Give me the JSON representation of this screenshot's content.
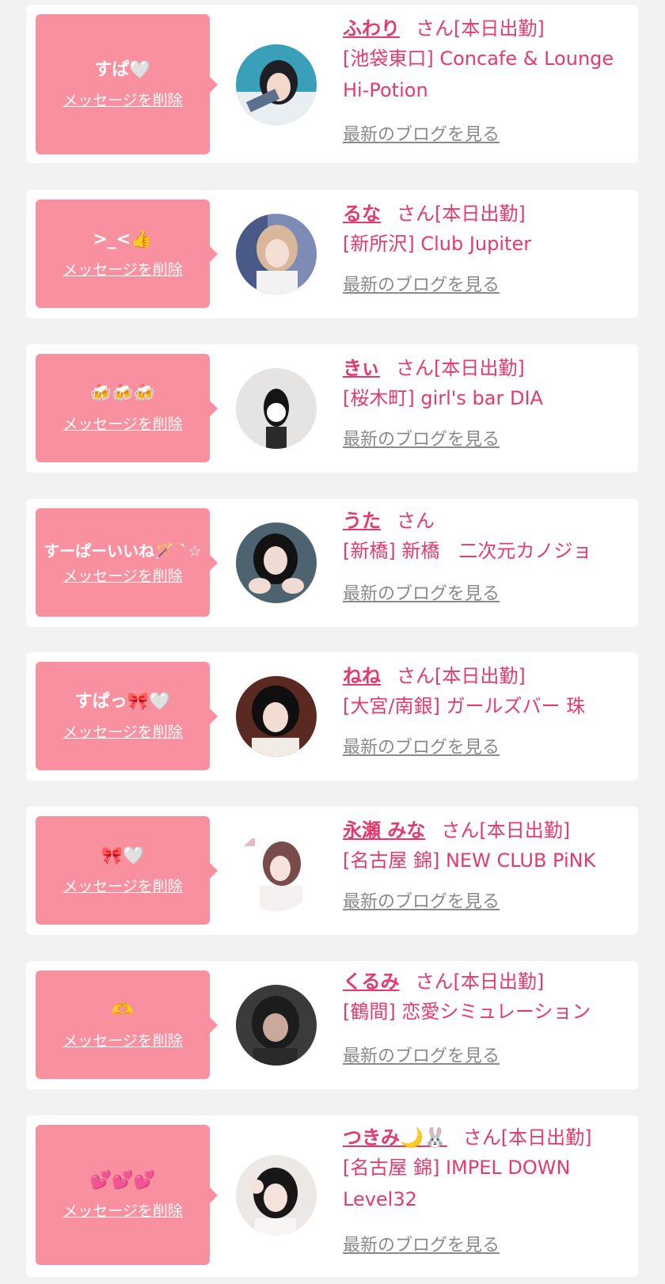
{
  "labels": {
    "delete": "メッセージを削除",
    "blog": "最新のブログを見る"
  },
  "colors": {
    "accent": "#e5386c",
    "bubble": "#f9909f",
    "muted": "#8a8a8a",
    "background": "#f2f2f2"
  },
  "messages": [
    {
      "message_text": "すぱ🤍",
      "name": "ふわり",
      "suffix": "さん[本日出勤]",
      "shop": "[池袋東口] Concafe & Lounge Hi-Potion",
      "avatar_icon": "profile-photo"
    },
    {
      "message_text": ">_<👍",
      "name": "るな",
      "suffix": "さん[本日出勤]",
      "shop": "[新所沢] Club Jupiter",
      "avatar_icon": "profile-photo"
    },
    {
      "message_text": "🍻🍻🍻",
      "name": "きぃ",
      "suffix": "さん[本日出勤]",
      "shop": "[桜木町] girl's bar DIA",
      "avatar_icon": "profile-photo"
    },
    {
      "message_text": "すーぱーいいね🪄 ˋ☆",
      "name": "うた",
      "suffix": "さん",
      "shop": "[新橋] 新橋　二次元カノジョ",
      "avatar_icon": "profile-photo"
    },
    {
      "message_text": "すぱっ🎀🤍",
      "name": "ねね",
      "suffix": "さん[本日出勤]",
      "shop": "[大宮/南銀] ガールズバー 珠",
      "avatar_icon": "profile-photo"
    },
    {
      "message_text": "🎀🤍",
      "name": "永瀬 みな",
      "suffix": "さん[本日出勤]",
      "shop": "[名古屋 錦] NEW CLUB PiNK",
      "avatar_icon": "profile-photo"
    },
    {
      "message_text": "🫶",
      "name": "くるみ",
      "suffix": "さん[本日出勤]",
      "shop": "[鶴間] 恋愛シミュレーション",
      "avatar_icon": "profile-photo"
    },
    {
      "message_text": "💕💕💕",
      "name": "つきみ🌙🐰",
      "suffix": "さん[本日出勤]",
      "shop": "[名古屋 錦] IMPEL DOWN Level32",
      "avatar_icon": "profile-photo"
    }
  ]
}
